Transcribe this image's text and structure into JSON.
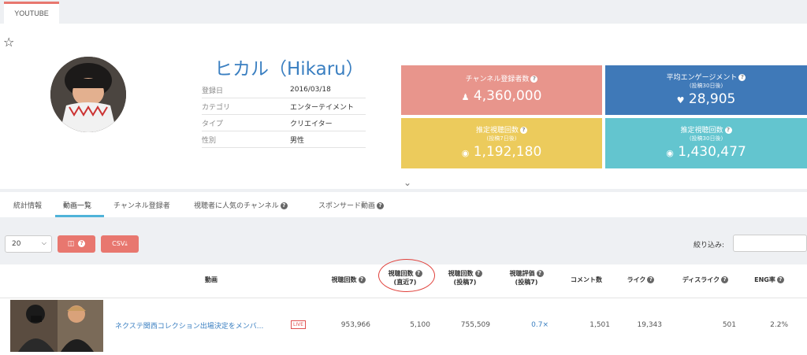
{
  "top_tabs": [
    {
      "label": "YOUTUBE"
    }
  ],
  "channel": {
    "name": "ヒカル（Hikaru）",
    "info": [
      {
        "key": "登録日",
        "value": "2016/03/18"
      },
      {
        "key": "カテゴリ",
        "value": "エンターテイメント"
      },
      {
        "key": "タイプ",
        "value": "クリエイター"
      },
      {
        "key": "性別",
        "value": "男性"
      }
    ]
  },
  "stats": [
    {
      "label": "チャンネル登録者数",
      "sub": "",
      "value": "4,360,000",
      "icon": "person-icon",
      "color": "#e8958c"
    },
    {
      "label": "平均エンゲージメント",
      "sub": "(投稿30日後)",
      "value": "28,905",
      "icon": "heart-icon",
      "color": "#3f79b8"
    },
    {
      "label": "推定視聴回数",
      "sub": "(投稿7日後)",
      "value": "1,192,180",
      "icon": "eye-icon",
      "color": "#eccb5c"
    },
    {
      "label": "推定視聴回数",
      "sub": "(投稿30日後)",
      "value": "1,430,477",
      "icon": "eye-icon",
      "color": "#63c5cf"
    }
  ],
  "section_tabs": [
    {
      "label": "統計情報"
    },
    {
      "label": "動画一覧"
    },
    {
      "label": "チャンネル登録者"
    },
    {
      "label": "視聴者に人気のチャンネル"
    },
    {
      "label": "スポンサード動画"
    }
  ],
  "toolbar": {
    "page_size": "20",
    "csv_label": "CSV",
    "filter_label": "絞り込み:",
    "filter_placeholder": ""
  },
  "table": {
    "headers": [
      {
        "label": "動画",
        "sub": ""
      },
      {
        "label": "視聴回数",
        "sub": ""
      },
      {
        "label": "視聴回数",
        "sub": "(直近7)"
      },
      {
        "label": "視聴回数",
        "sub": "(投稿7)"
      },
      {
        "label": "視聴評価",
        "sub": "(投稿7)"
      },
      {
        "label": "コメント数",
        "sub": ""
      },
      {
        "label": "ライク",
        "sub": ""
      },
      {
        "label": "ディスライク",
        "sub": ""
      },
      {
        "label": "ENG率",
        "sub": ""
      }
    ],
    "rows": [
      {
        "title": "ネクステ関西コレクション出場決定をメンバ...",
        "badge": "LIVE",
        "views": "953,966",
        "views_recent7": "5,100",
        "views_post7": "755,509",
        "rating_post7": "0.7×",
        "comments": "1,501",
        "likes": "19,343",
        "dislikes": "501",
        "eng_rate": "2.2%"
      }
    ]
  }
}
